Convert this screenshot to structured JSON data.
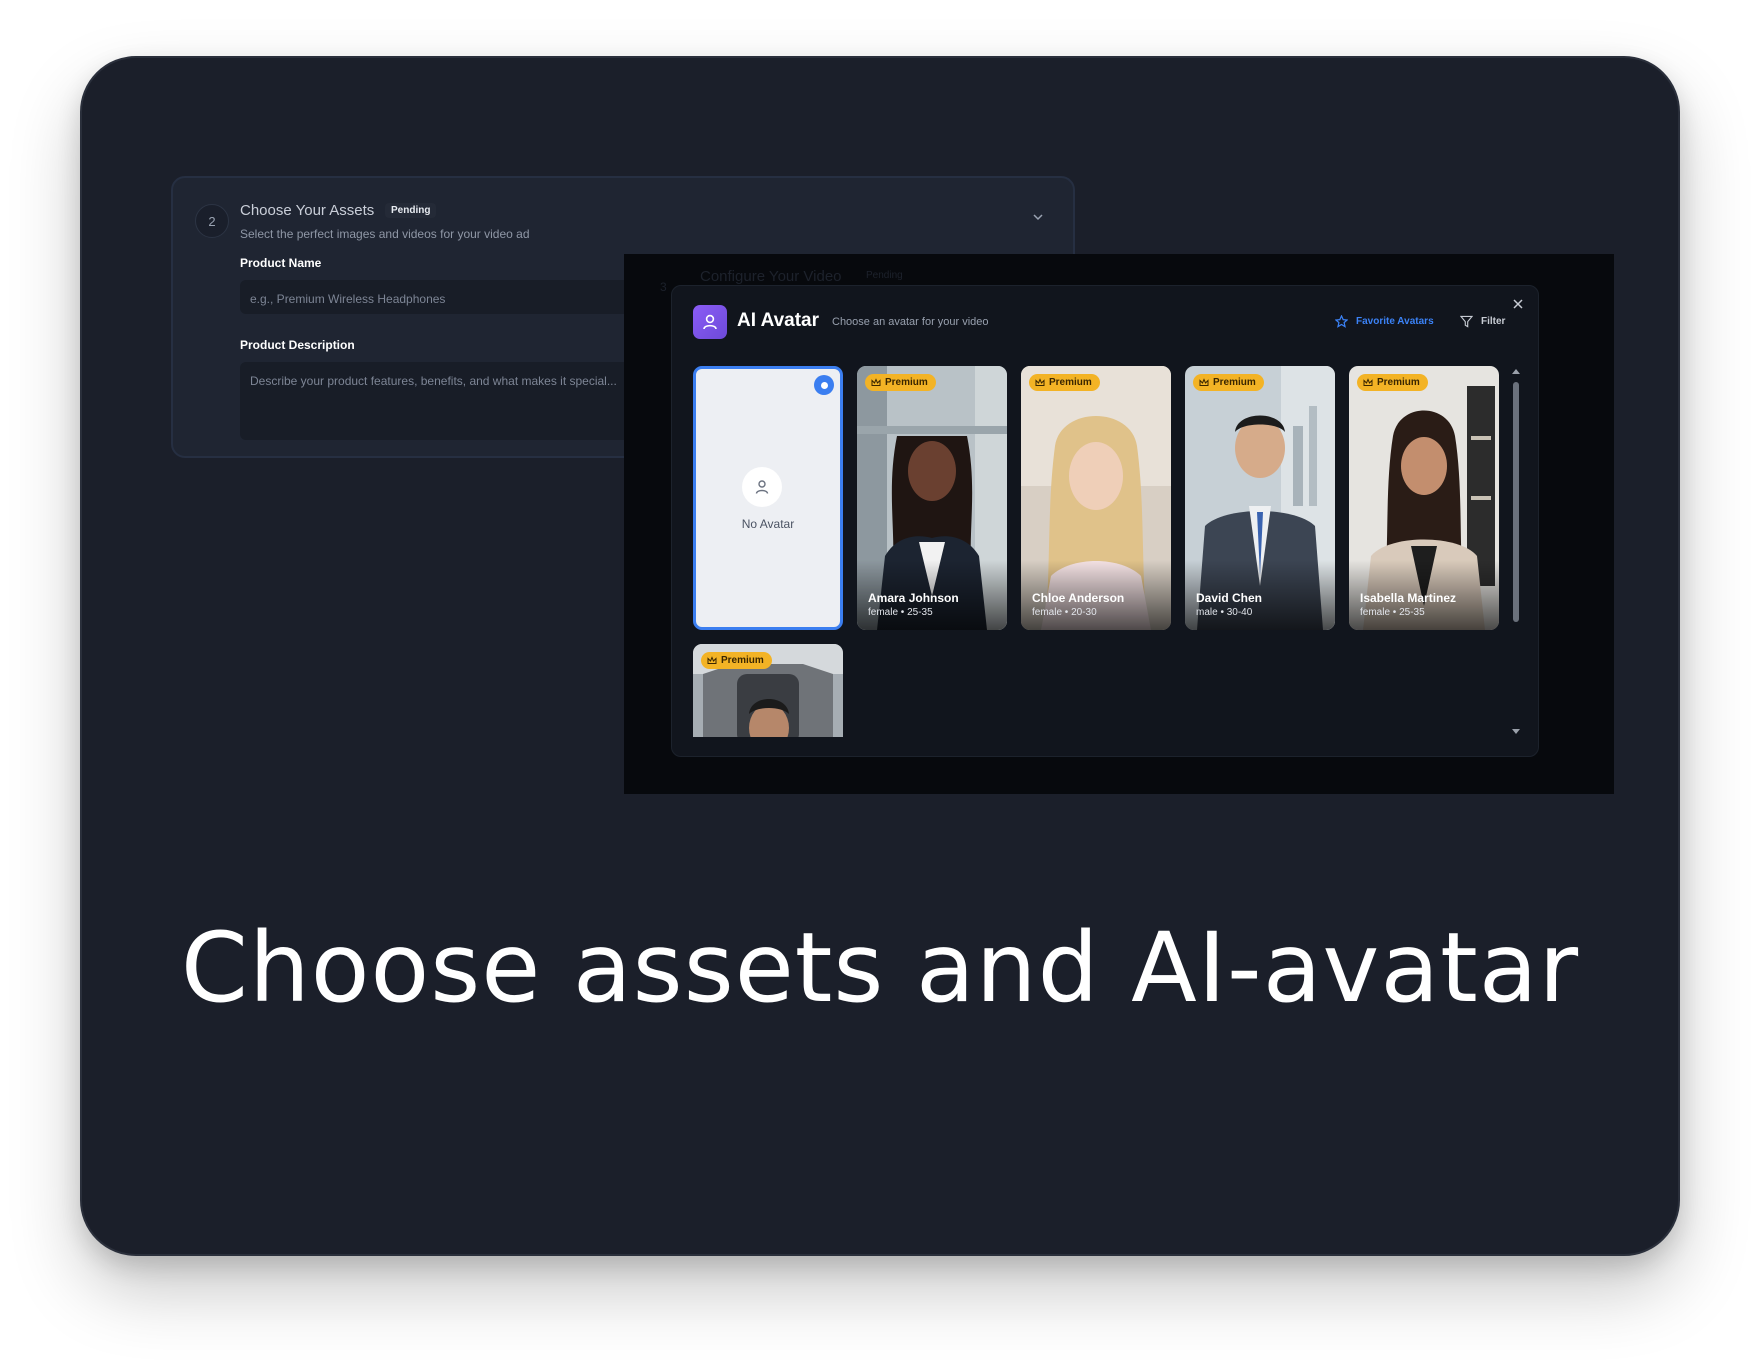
{
  "headline": "Choose assets and AI-avatar",
  "step": {
    "number": "2",
    "title": "Choose Your Assets",
    "status": "Pending",
    "subtitle": "Select the perfect images and videos for your video ad",
    "product_name_label": "Product Name",
    "product_name_placeholder": "e.g., Premium Wireless Headphones",
    "product_description_label": "Product Description",
    "product_description_placeholder": "Describe your product features, benefits, and what makes it special..."
  },
  "next_step": {
    "number": "3",
    "title": "Configure Your Video",
    "status": "Pending"
  },
  "modal": {
    "title": "AI Avatar",
    "subtitle": "Choose an avatar for your video",
    "favorite_label": "Favorite Avatars",
    "filter_label": "Filter",
    "no_avatar_label": "No Avatar",
    "premium_label": "Premium",
    "avatars": [
      {
        "name": "Amara Johnson",
        "meta": "female • 25-35"
      },
      {
        "name": "Chloe Anderson",
        "meta": "female • 20-30"
      },
      {
        "name": "David Chen",
        "meta": "male • 30-40"
      },
      {
        "name": "Isabella Martinez",
        "meta": "female • 25-35"
      }
    ]
  },
  "colors": {
    "accent_blue": "#3b82f6",
    "premium_yellow": "#f3b325",
    "card_bg": "#1b1f2a",
    "modal_icon_purple": "#8b5cf6"
  }
}
